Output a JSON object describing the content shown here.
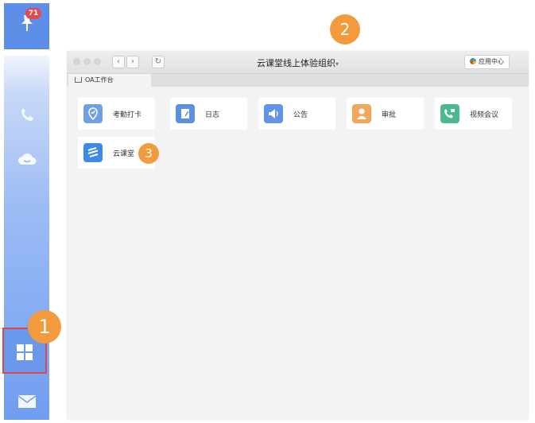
{
  "sidebar": {
    "notification_badge": "71",
    "items": [
      "pin-icon",
      "phone-icon",
      "cloud-icon",
      "apps-grid-icon",
      "mail-icon"
    ]
  },
  "markers": [
    "1",
    "2",
    "3"
  ],
  "window": {
    "title": "云课堂线上体验组织",
    "title_suffix": "▾",
    "app_center_label": "应用中心",
    "tab_label": "OA工作台"
  },
  "apps": [
    {
      "label": "考勤打卡",
      "icon": "location-icon",
      "color": "#6fa0e9"
    },
    {
      "label": "日志",
      "icon": "notebook-icon",
      "color": "#5b8fe2"
    },
    {
      "label": "公告",
      "icon": "megaphone-icon",
      "color": "#5f94e6"
    },
    {
      "label": "审批",
      "icon": "user-icon",
      "color": "#f0a85a"
    },
    {
      "label": "视频会议",
      "icon": "video-call-icon",
      "color": "#4cb98c"
    },
    {
      "label": "云课堂",
      "icon": "cloud-class-icon",
      "color": "#3c8ae6"
    }
  ],
  "colors": {
    "accent": "#5d8fe8",
    "marker": "#f39a3c",
    "highlight": "#e2454b"
  }
}
